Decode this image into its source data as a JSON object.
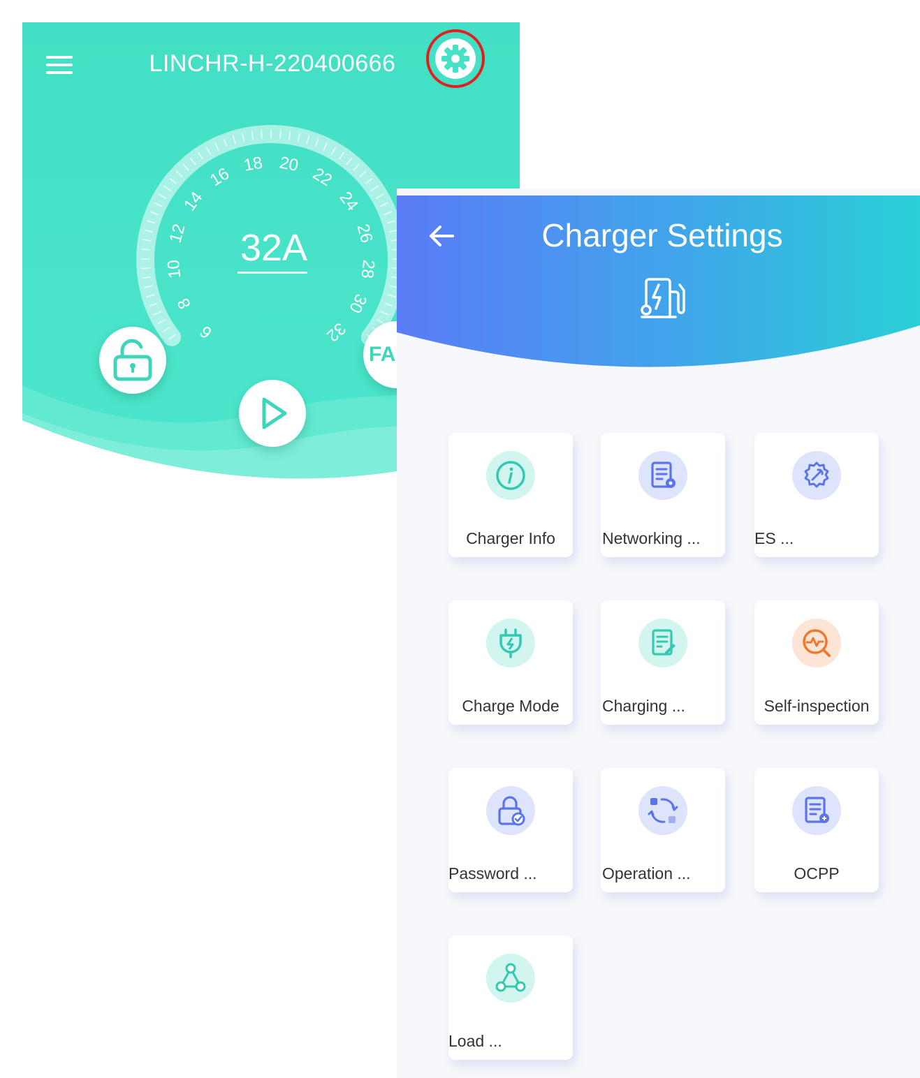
{
  "main": {
    "device_title": "LINCHR-H-220400666",
    "current": "32A",
    "fa_label": "FA",
    "dial_ticks": [
      "6",
      "8",
      "10",
      "12",
      "14",
      "16",
      "18",
      "20",
      "22",
      "24",
      "26",
      "28",
      "30",
      "32"
    ]
  },
  "settings": {
    "title": "Charger Settings",
    "tiles": [
      {
        "label": "Charger Info",
        "icon": "info-icon"
      },
      {
        "label": "Networking ...",
        "icon": "network-doc-icon"
      },
      {
        "label": "ES ...",
        "icon": "gear-wrench-icon"
      },
      {
        "label": "Charge Mode",
        "icon": "plug-icon"
      },
      {
        "label": "Charging ...",
        "icon": "charging-doc-icon"
      },
      {
        "label": "Self-inspection",
        "icon": "inspection-icon"
      },
      {
        "label": "Password ...",
        "icon": "password-lock-icon"
      },
      {
        "label": "Operation ...",
        "icon": "operation-cycle-icon"
      },
      {
        "label": "OCPP",
        "icon": "ocpp-doc-icon"
      },
      {
        "label": "Load ...",
        "icon": "load-network-icon"
      }
    ]
  },
  "colors": {
    "main_teal": "#45e1c6",
    "settings_gradient_start": "#5b7cf7",
    "settings_gradient_end": "#2ad0d6",
    "highlight_ring": "#e02020",
    "icon_teal": "#33c9b0",
    "icon_blue": "#5b74e8",
    "icon_orange": "#f0772e"
  }
}
